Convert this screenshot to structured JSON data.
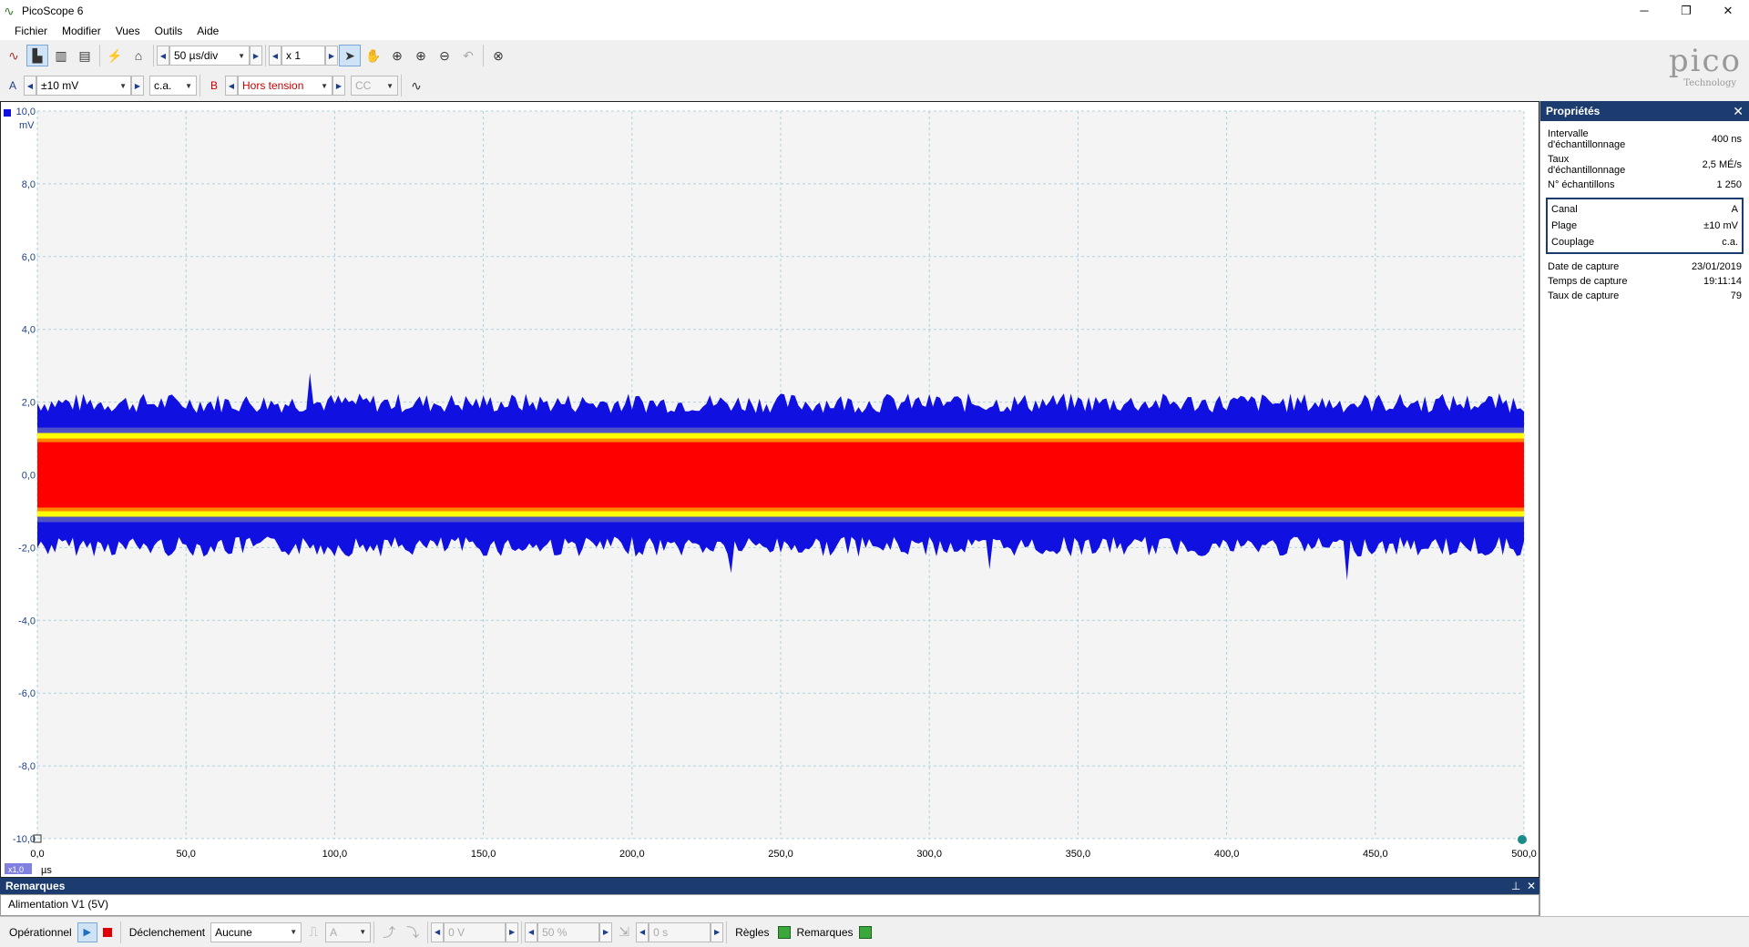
{
  "window": {
    "title": "PicoScope 6"
  },
  "menu": [
    "Fichier",
    "Modifier",
    "Vues",
    "Outils",
    "Aide"
  ],
  "toolbar1": {
    "timebase": "50 µs/div",
    "zoom": "x 1"
  },
  "toolbar2": {
    "channel_a_label": "A",
    "channel_a_range": "±10 mV",
    "channel_a_coupling": "c.a.",
    "channel_b_label": "B",
    "channel_b_range": "Hors tension",
    "channel_b_coupling": "CC"
  },
  "logo": {
    "brand": "pico",
    "sub": "Technology"
  },
  "scope": {
    "y_unit": "mV",
    "x_unit": "µs",
    "x_zoom_badge": "x1,0"
  },
  "chart_data": {
    "type": "line",
    "title": "",
    "xlabel": "µs",
    "ylabel": "mV",
    "xlim": [
      0,
      500
    ],
    "ylim": [
      -10,
      10
    ],
    "x_ticks": [
      "0,0",
      "50,0",
      "100,0",
      "150,0",
      "200,0",
      "250,0",
      "300,0",
      "350,0",
      "400,0",
      "450,0",
      "500,0"
    ],
    "y_ticks": [
      "10,0",
      "8,0",
      "6,0",
      "4,0",
      "2,0",
      "0,0",
      "-2,0",
      "-4,0",
      "-6,0",
      "-8,0",
      "-10,0"
    ],
    "grid": true,
    "series": [
      {
        "color": "#1010e0",
        "band": {
          "min": -2.0,
          "max": 2.0
        },
        "peaks": [
          {
            "x": 92,
            "y": 2.8
          },
          {
            "x": 233,
            "y": -2.7
          },
          {
            "x": 320,
            "y": -2.6
          },
          {
            "x": 440,
            "y": -2.9
          }
        ]
      }
    ],
    "persistence_colors": {
      "core": "#ff0000",
      "mid": "#ffff00",
      "outer": "#1010e0"
    }
  },
  "remarks": {
    "header": "Remarques",
    "text": "Alimentation V1 (5V)"
  },
  "properties": {
    "header": "Propriétés",
    "rows": [
      {
        "label": "Intervalle d'échantillonnage",
        "value": "400 ns"
      },
      {
        "label": "Taux d'échantillonnage",
        "value": "2,5 MÉ/s"
      },
      {
        "label": "N° échantillons",
        "value": "1 250"
      }
    ],
    "channel_box": [
      {
        "label": "Canal",
        "value": "A"
      },
      {
        "label": "Plage",
        "value": "±10 mV"
      },
      {
        "label": "Couplage",
        "value": "c.a."
      }
    ],
    "capture_rows": [
      {
        "label": "Date de capture",
        "value": "23/01/2019"
      },
      {
        "label": "Temps de capture",
        "value": "19:11:14"
      },
      {
        "label": "Taux de capture",
        "value": "79"
      }
    ]
  },
  "statusbar": {
    "mode": "Opérationnel",
    "trigger_label": "Déclenchement",
    "trigger_value": "Aucune",
    "trigger_channel": "A",
    "trigger_level": "0 V",
    "pre_trigger": "50 %",
    "delay": "0 s",
    "rules": "Règles",
    "notes": "Remarques"
  }
}
